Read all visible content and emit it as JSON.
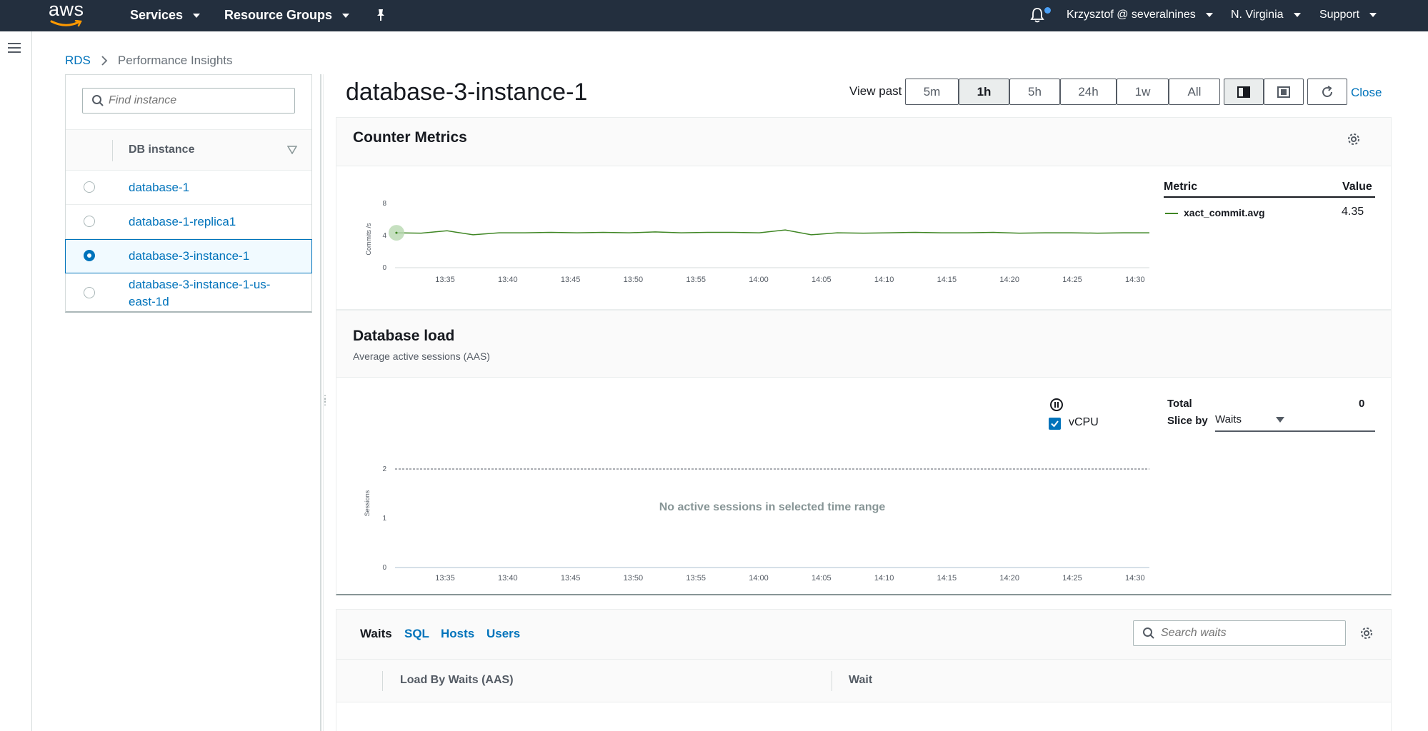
{
  "topnav": {
    "logo_text": "aws",
    "services": "Services",
    "resource_groups": "Resource Groups",
    "account": "Krzysztof @ severalnines",
    "region": "N. Virginia",
    "support": "Support"
  },
  "breadcrumb": {
    "root": "RDS",
    "current": "Performance Insights"
  },
  "instances": {
    "search_placeholder": "Find instance",
    "column_header": "DB instance",
    "items": [
      {
        "label": "database-1",
        "selected": false
      },
      {
        "label": "database-1-replica1",
        "selected": false
      },
      {
        "label": "database-3-instance-1",
        "selected": true
      },
      {
        "label": "database-3-instance-1-us-east-1d",
        "selected": false
      }
    ]
  },
  "main": {
    "title": "database-3-instance-1",
    "view_past_label": "View past",
    "ranges": [
      "5m",
      "1h",
      "5h",
      "24h",
      "1w",
      "All"
    ],
    "active_range": "1h",
    "close": "Close"
  },
  "counter_metrics": {
    "title": "Counter Metrics",
    "metric_header": "Metric",
    "value_header": "Value",
    "metrics": [
      {
        "name": "xact_commit.avg",
        "value": "4.35"
      }
    ],
    "chart_data": {
      "type": "line",
      "ylabel": "Commits /s",
      "y_ticks": [
        "0",
        "4",
        "8"
      ],
      "ylim": [
        0,
        8
      ],
      "x_ticks": [
        "13:35",
        "13:40",
        "13:45",
        "13:50",
        "13:55",
        "14:00",
        "14:05",
        "14:10",
        "14:15",
        "14:20",
        "14:25",
        "14:30"
      ],
      "series": [
        {
          "values": [
            4.35,
            4.3,
            4.6,
            4.1,
            4.35,
            4.35,
            4.4,
            4.35,
            4.4,
            4.35,
            4.45,
            4.35,
            4.4,
            4.4,
            4.35,
            4.7,
            4.1,
            4.35,
            4.3,
            4.35,
            4.4,
            4.35,
            4.35,
            4.4,
            4.3,
            4.35,
            4.35,
            4.3,
            4.35,
            4.35
          ]
        }
      ],
      "color": "#3f8624"
    }
  },
  "db_load": {
    "title": "Database load",
    "subtitle": "Average active sessions (AAS)",
    "vcpu_label": "vCPU",
    "total_label": "Total",
    "total_value": "0",
    "slice_label": "Slice by",
    "slice_value": "Waits",
    "empty_message": "No active sessions in selected time range",
    "chart_data": {
      "type": "area",
      "ylabel": "Sessions",
      "y_ticks": [
        "0",
        "1",
        "2"
      ],
      "ylim": [
        0,
        2
      ],
      "max_vcpu": 2,
      "x_ticks": [
        "13:35",
        "13:40",
        "13:45",
        "13:50",
        "13:55",
        "14:00",
        "14:05",
        "14:10",
        "14:15",
        "14:20",
        "14:25",
        "14:30"
      ],
      "series": []
    }
  },
  "waits": {
    "tabs": [
      "Waits",
      "SQL",
      "Hosts",
      "Users"
    ],
    "active_tab": "Waits",
    "search_placeholder": "Search waits",
    "col_load": "Load By Waits (AAS)",
    "col_wait": "Wait"
  }
}
